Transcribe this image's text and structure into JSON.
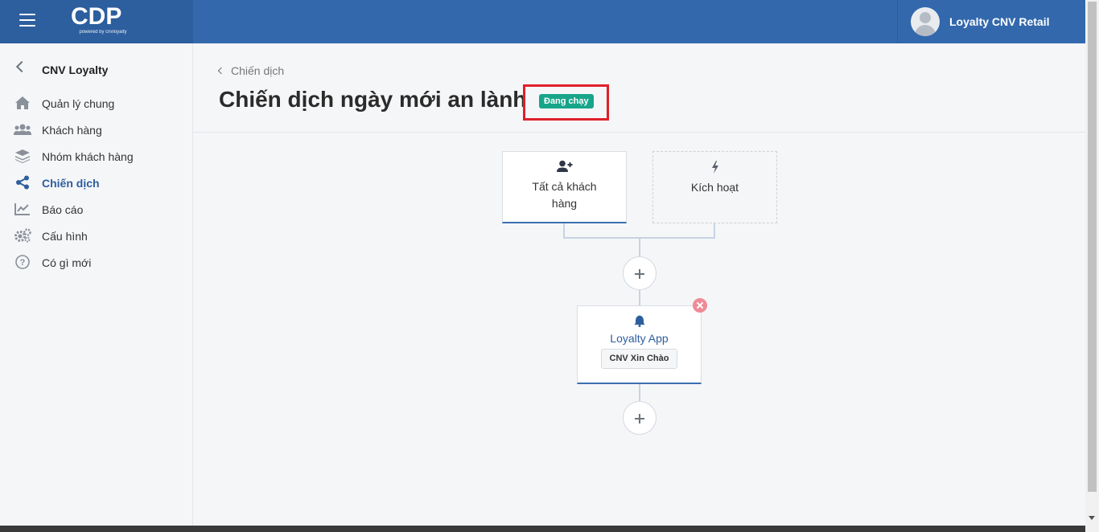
{
  "header": {
    "logo_text": "CDP",
    "logo_sub": "powered by cnvloyalty",
    "user_name": "Loyalty CNV Retail"
  },
  "sidebar": {
    "title": "CNV Loyalty",
    "items": [
      {
        "label": "Quản lý chung",
        "icon": "home-icon"
      },
      {
        "label": "Khách hàng",
        "icon": "users-icon"
      },
      {
        "label": "Nhóm khách hàng",
        "icon": "layers-icon"
      },
      {
        "label": "Chiến dịch",
        "icon": "share-icon",
        "active": true
      },
      {
        "label": "Báo cáo",
        "icon": "chart-line-icon"
      },
      {
        "label": "Cấu hình",
        "icon": "gears-icon"
      },
      {
        "label": "Có gì mới",
        "icon": "question-circle-icon"
      }
    ]
  },
  "main": {
    "breadcrumb": "Chiến dịch",
    "title": "Chiến dịch ngày mới an lành",
    "status": "Đang chạy"
  },
  "flow": {
    "audience_label": "Tất cả khách hàng",
    "trigger_label": "Kích hoạt",
    "action_app": "Loyalty App",
    "action_message": "CNV Xin Chào"
  },
  "colors": {
    "topbar": "#3368ad",
    "accent": "#2d5e9e",
    "status_badge": "#17a589",
    "highlight": "#e0202a",
    "close": "#ef8a97"
  }
}
